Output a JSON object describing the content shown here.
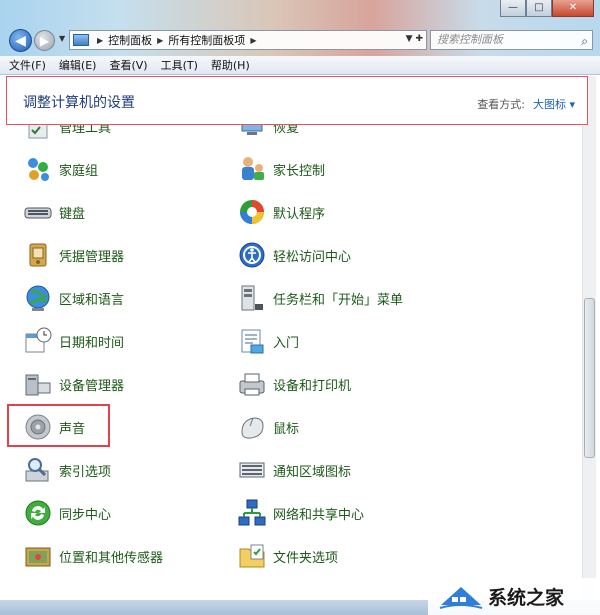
{
  "window": {
    "minimize_glyph": "—",
    "maximize_glyph": "□",
    "close_glyph": "✕"
  },
  "nav": {
    "breadcrumbs": [
      "控制面板",
      "所有控制面板项"
    ],
    "refresh_glyph": "✚",
    "search_placeholder": "搜索控制面板"
  },
  "menu": [
    "文件(F)",
    "编辑(E)",
    "查看(V)",
    "工具(T)",
    "帮助(H)"
  ],
  "header": {
    "title": "调整计算机的设置",
    "view_by_label": "查看方式:",
    "view_by_value": "大图标 ▾"
  },
  "items_left": [
    {
      "label": "管理工具",
      "icon": "admin-tools-icon"
    },
    {
      "label": "家庭组",
      "icon": "homegroup-icon"
    },
    {
      "label": "键盘",
      "icon": "keyboard-icon"
    },
    {
      "label": "凭据管理器",
      "icon": "credential-manager-icon"
    },
    {
      "label": "区域和语言",
      "icon": "region-language-icon"
    },
    {
      "label": "日期和时间",
      "icon": "date-time-icon"
    },
    {
      "label": "设备管理器",
      "icon": "device-manager-icon"
    },
    {
      "label": "声音",
      "icon": "sound-icon"
    },
    {
      "label": "索引选项",
      "icon": "indexing-options-icon"
    },
    {
      "label": "同步中心",
      "icon": "sync-center-icon"
    },
    {
      "label": "位置和其他传感器",
      "icon": "location-sensors-icon"
    }
  ],
  "items_right": [
    {
      "label": "恢复",
      "icon": "recovery-icon"
    },
    {
      "label": "家长控制",
      "icon": "parental-controls-icon"
    },
    {
      "label": "默认程序",
      "icon": "default-programs-icon"
    },
    {
      "label": "轻松访问中心",
      "icon": "ease-of-access-icon"
    },
    {
      "label": "任务栏和「开始」菜单",
      "icon": "taskbar-start-menu-icon"
    },
    {
      "label": "入门",
      "icon": "getting-started-icon"
    },
    {
      "label": "设备和打印机",
      "icon": "devices-printers-icon"
    },
    {
      "label": "鼠标",
      "icon": "mouse-icon"
    },
    {
      "label": "通知区域图标",
      "icon": "notification-area-icon"
    },
    {
      "label": "网络和共享中心",
      "icon": "network-sharing-icon"
    },
    {
      "label": "文件夹选项",
      "icon": "folder-options-icon"
    }
  ],
  "watermark": {
    "text": "系统之家"
  },
  "colors": {
    "item_label": "#1c5a18",
    "highlight_border": "#e2424c",
    "title": "#1e3d7b",
    "link": "#1c63b5"
  }
}
